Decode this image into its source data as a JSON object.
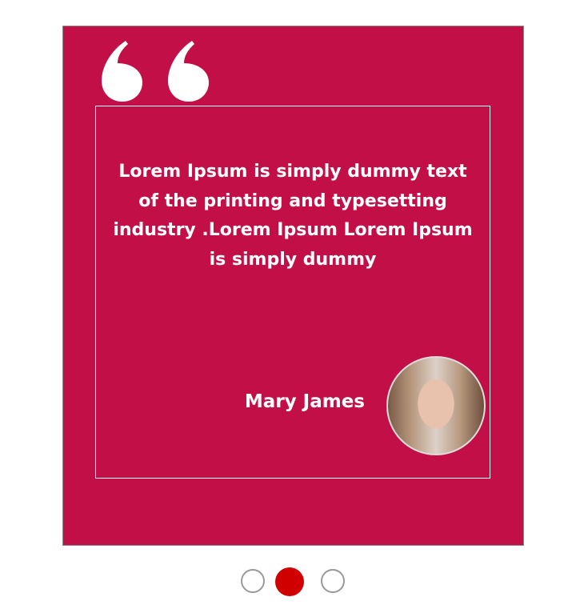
{
  "testimonial": {
    "quote": "Lorem Ipsum is simply dummy text of the printing and typesetting industry .Lorem Ipsum Lorem Ipsum is simply dummy",
    "author": "Mary James"
  },
  "carousel": {
    "count": 3,
    "active_index": 1
  },
  "colors": {
    "card": "#c30f47",
    "active_dot": "#d10000"
  }
}
